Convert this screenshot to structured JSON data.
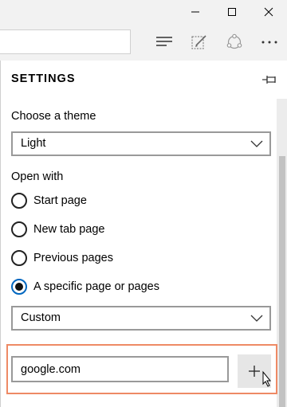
{
  "window_controls": {
    "minimize_icon": "minimize-icon",
    "maximize_icon": "maximize-icon",
    "close_icon": "close-icon"
  },
  "toolbar": {
    "icons": [
      "hub-icon",
      "web-note-icon",
      "share-icon",
      "more-icon"
    ]
  },
  "settings": {
    "title": "SETTINGS",
    "theme": {
      "label": "Choose a theme",
      "selected": "Light"
    },
    "open_with": {
      "label": "Open with",
      "options": [
        {
          "label": "Start page",
          "checked": false
        },
        {
          "label": "New tab page",
          "checked": false
        },
        {
          "label": "Previous pages",
          "checked": false
        },
        {
          "label": "A specific page or pages",
          "checked": true
        }
      ],
      "page_select": "Custom",
      "url_value": "google.com",
      "add_icon": "plus-icon"
    }
  },
  "colors": {
    "highlight": "#ee8a65",
    "radio_accent": "#0067c0"
  }
}
